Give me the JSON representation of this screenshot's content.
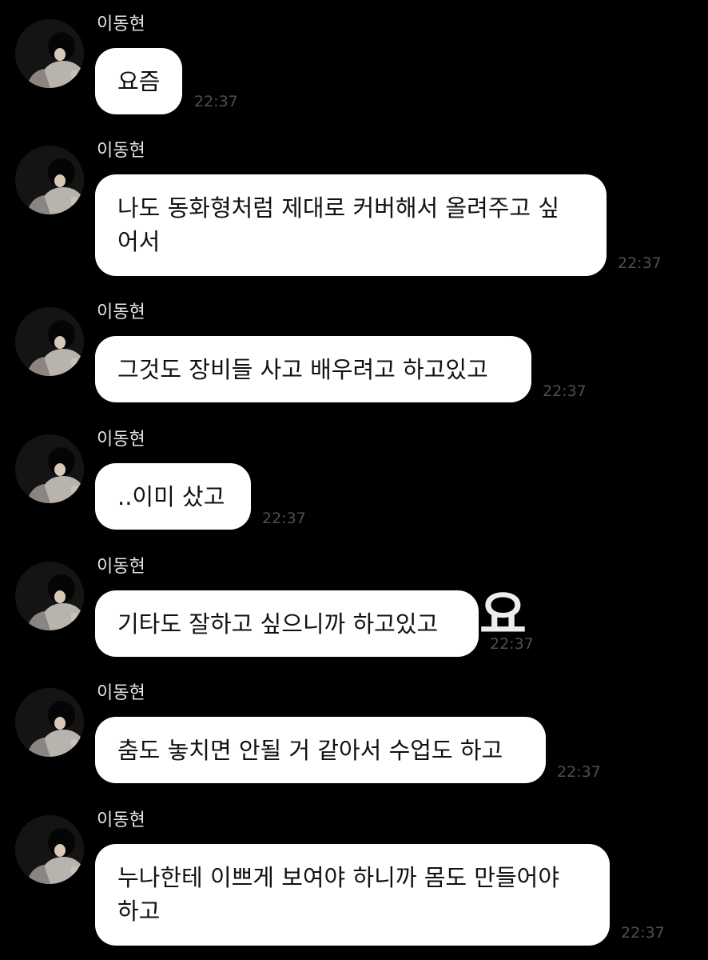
{
  "chat": {
    "messages": [
      {
        "sender": "이동현",
        "lines": [
          "요즘"
        ],
        "time": "22:37"
      },
      {
        "sender": "이동현",
        "lines": [
          "나도 동화형처럼 제대로 커버해서 올려주고 싶",
          "어서"
        ],
        "time": "22:37"
      },
      {
        "sender": "이동현",
        "lines": [
          "그것도 장비들 사고 배우려고 하고있고"
        ],
        "time": "22:37"
      },
      {
        "sender": "이동현",
        "lines": [
          "..이미 샀고"
        ],
        "time": "22:37"
      },
      {
        "sender": "이동현",
        "lines": [
          "기타도 잘하고 싶으니까 하고있고"
        ],
        "time": "22:37"
      },
      {
        "sender": "이동현",
        "lines": [
          "춤도 놓치면 안될 거 같아서 수업도 하고"
        ],
        "time": "22:37"
      },
      {
        "sender": "이동현",
        "lines": [
          "누나한테 이쁘게 보여야 하니까 몸도 만들어야",
          "하고"
        ],
        "time": "22:37"
      }
    ]
  },
  "watermark": {
    "text": "요"
  },
  "colors": {
    "background": "#000000",
    "bubble": "#ffffff",
    "bubble_text": "#111111",
    "sender_text": "#e6e6e6",
    "time_text": "#4f4f4f"
  }
}
